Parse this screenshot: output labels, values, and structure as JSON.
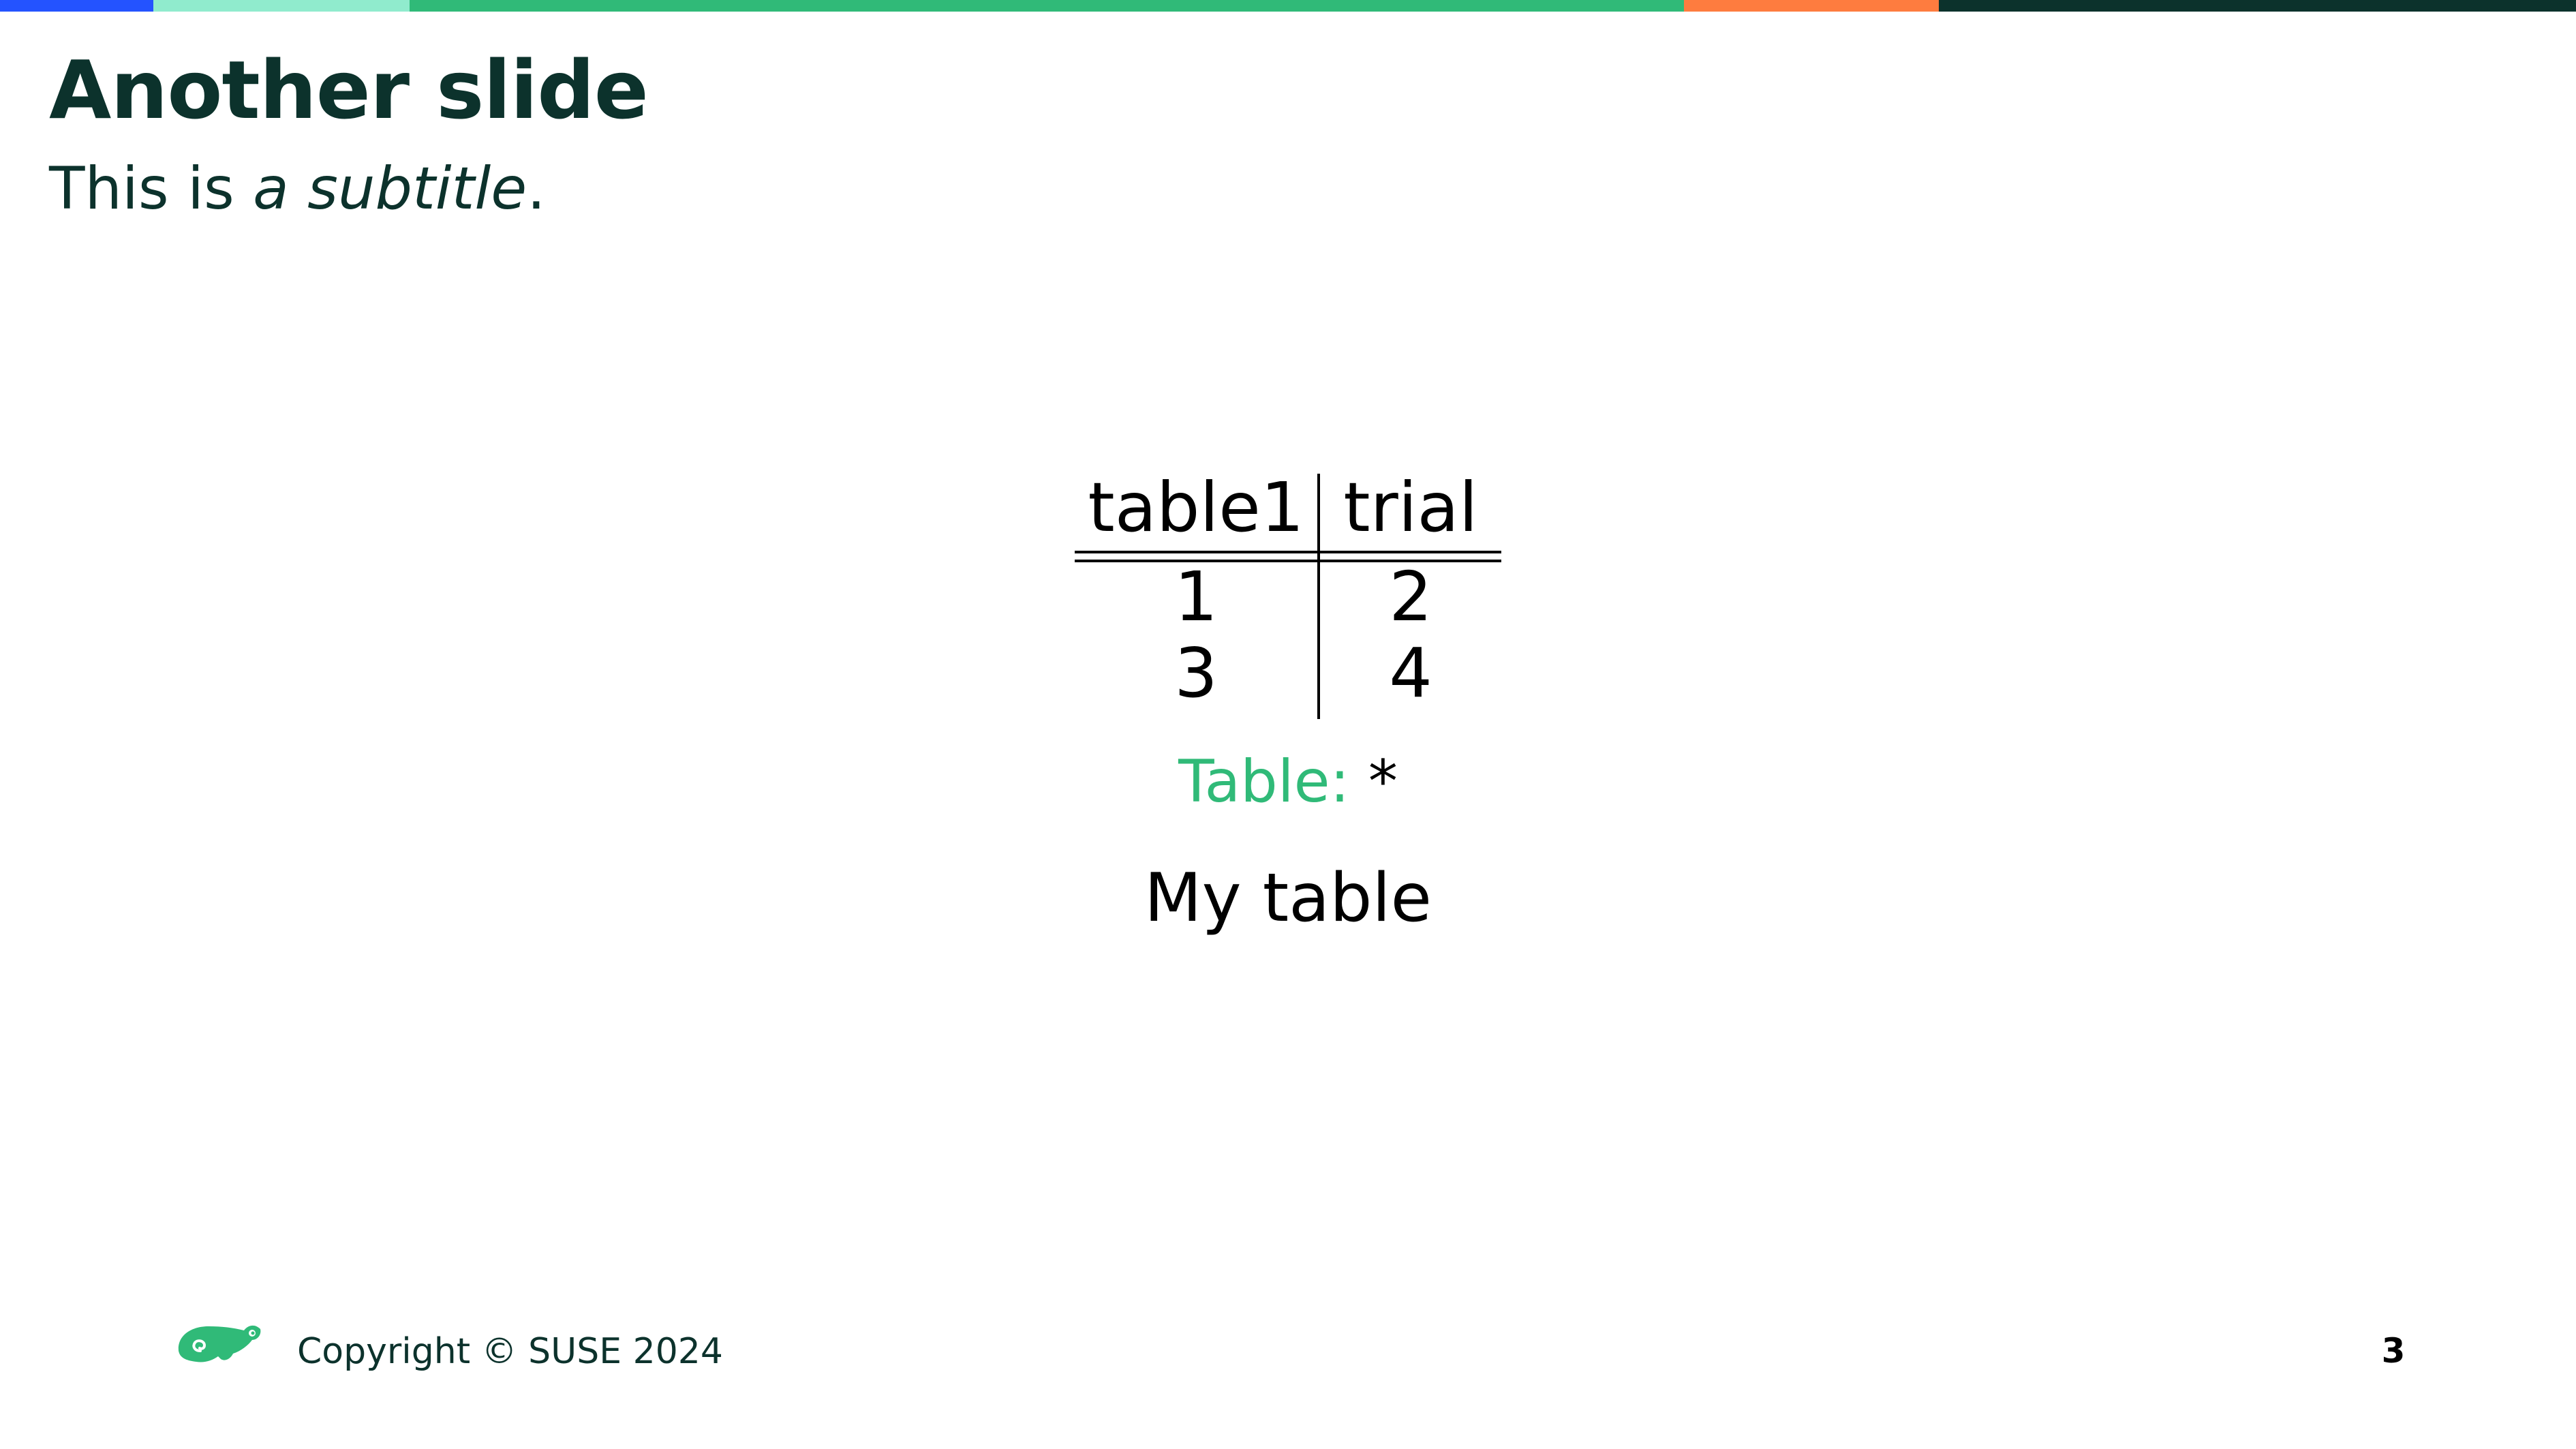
{
  "slide": {
    "title": "Another slide",
    "subtitle_plain": "This is ",
    "subtitle_emphasis": "a subtitle",
    "subtitle_end": "."
  },
  "table": {
    "headers": [
      "table1",
      "trial"
    ],
    "rows": [
      [
        "1",
        "2"
      ],
      [
        "3",
        "4"
      ]
    ]
  },
  "caption": {
    "label": "Table:",
    "text": "*"
  },
  "table_title": "My table",
  "footer": {
    "logo_icon": "suse-chameleon-icon",
    "copyright": "Copyright © SUSE 2024",
    "page_number": "3"
  },
  "colors": {
    "title": "#0c322c",
    "accent_green": "#30ba78",
    "bar": [
      "#2453ff",
      "#90ebcd",
      "#30ba78",
      "#fe7c3f",
      "#0c322c"
    ]
  }
}
